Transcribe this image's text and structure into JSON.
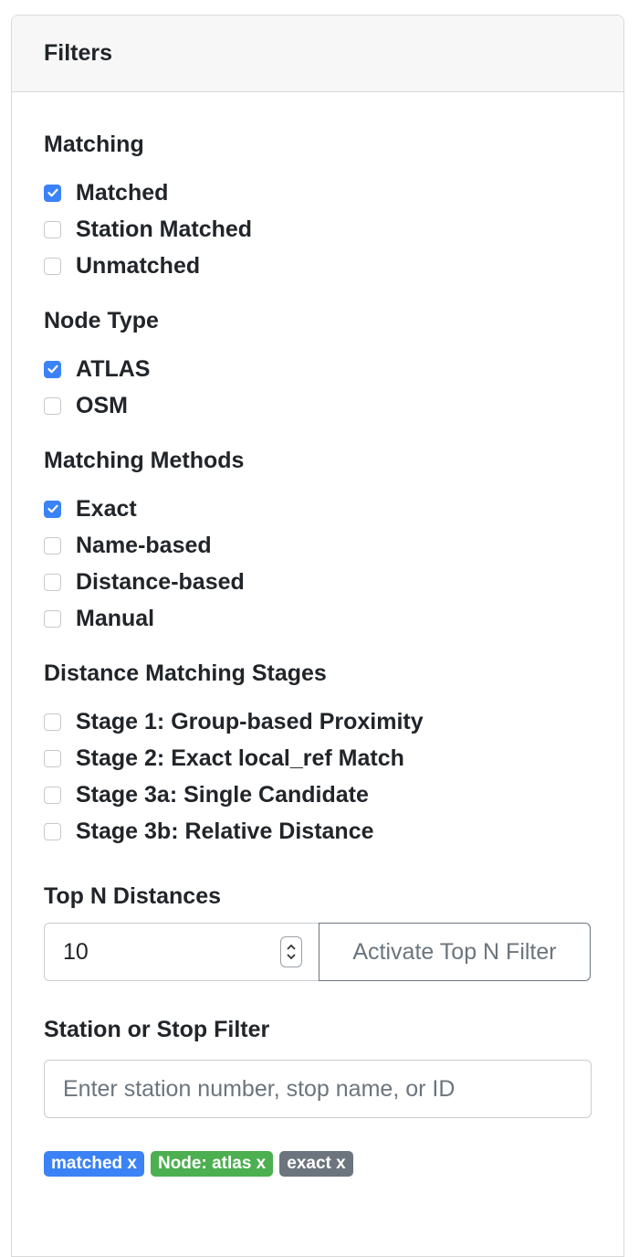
{
  "header": {
    "title": "Filters"
  },
  "matching": {
    "title": "Matching",
    "items": [
      {
        "label": "Matched",
        "checked": true
      },
      {
        "label": "Station Matched",
        "checked": false
      },
      {
        "label": "Unmatched",
        "checked": false
      }
    ]
  },
  "node_type": {
    "title": "Node Type",
    "items": [
      {
        "label": "ATLAS",
        "checked": true
      },
      {
        "label": "OSM",
        "checked": false
      }
    ]
  },
  "methods": {
    "title": "Matching Methods",
    "items": [
      {
        "label": "Exact",
        "checked": true
      },
      {
        "label": "Name-based",
        "checked": false
      },
      {
        "label": "Distance-based",
        "checked": false
      },
      {
        "label": "Manual",
        "checked": false
      }
    ]
  },
  "stages": {
    "title": "Distance Matching Stages",
    "items": [
      {
        "label": "Stage 1: Group-based Proximity",
        "checked": false
      },
      {
        "label": "Stage 2: Exact local_ref Match",
        "checked": false
      },
      {
        "label": "Stage 3a: Single Candidate",
        "checked": false
      },
      {
        "label": "Stage 3b: Relative Distance",
        "checked": false
      }
    ]
  },
  "top_n": {
    "title": "Top N Distances",
    "value": "10",
    "button_label": "Activate Top N Filter"
  },
  "station_filter": {
    "title": "Station or Stop Filter",
    "placeholder": "Enter station number, stop name, or ID"
  },
  "badges": [
    {
      "label": "matched x",
      "color": "#3b82f6"
    },
    {
      "label": "Node: atlas x",
      "color": "#4caf50"
    },
    {
      "label": "exact x",
      "color": "#6c757d"
    }
  ],
  "colors": {
    "accent": "#3b82f6",
    "header_bg": "#f7f7f7"
  }
}
